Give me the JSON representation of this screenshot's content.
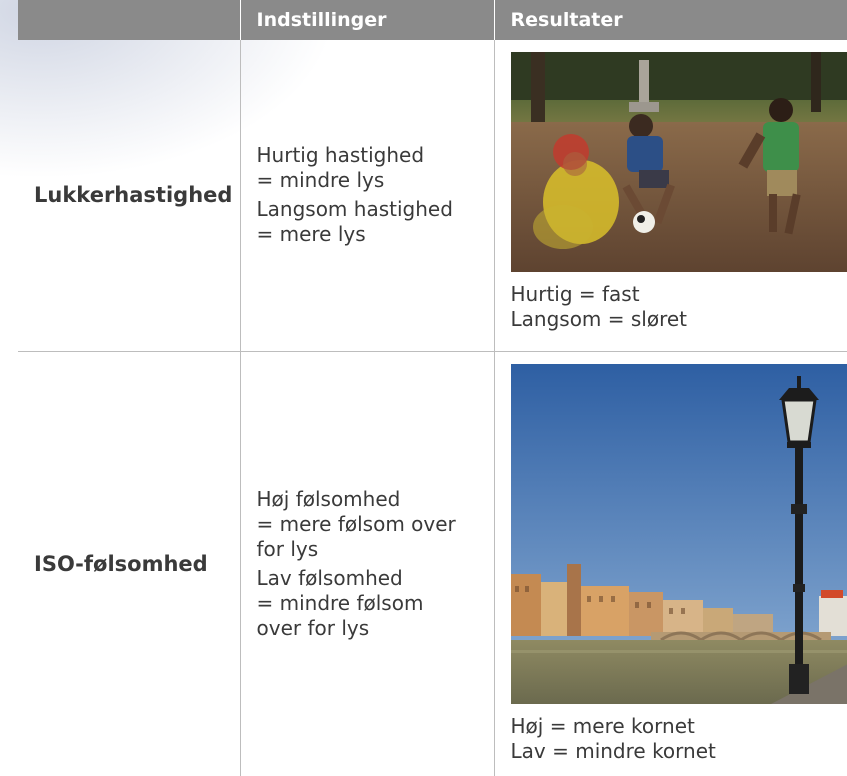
{
  "header": {
    "col1": "",
    "col2": "Indstillinger",
    "col3": "Resultater"
  },
  "rows": [
    {
      "parameter": "Lukkerhastighed",
      "settings": [
        [
          "Hurtig hastighed",
          "= mindre lys"
        ],
        [
          "Langsom hastighed",
          "= mere lys"
        ]
      ],
      "result_caption": [
        "Hurtig = fast",
        "Langsom = sløret"
      ]
    },
    {
      "parameter": "ISO-følsomhed",
      "settings": [
        [
          "Høj følsomhed",
          "= mere følsom over",
          "for lys"
        ],
        [
          "Lav følsomhed",
          "= mindre følsom",
          "over for lys"
        ]
      ],
      "result_caption": [
        "Høj = mere kornet",
        "Lav = mindre kornet"
      ]
    }
  ],
  "colors": {
    "header_bg": "#8a8a8a",
    "text": "#3a3a3a",
    "rule": "#bdbdbd"
  }
}
